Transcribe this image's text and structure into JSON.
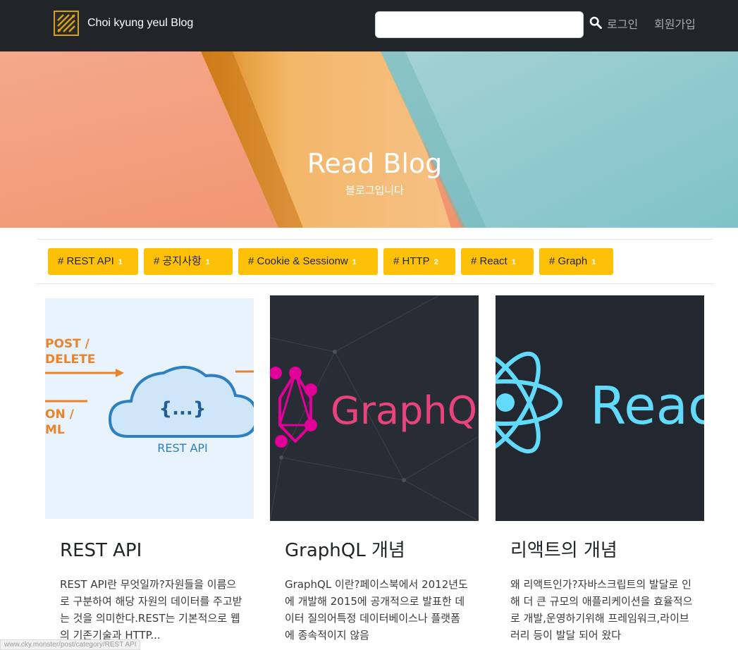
{
  "navbar": {
    "brand": "Choi kyung yeul Blog",
    "search": {
      "value": "",
      "placeholder": ""
    },
    "login": "로그인",
    "signup": "회원가입"
  },
  "hero": {
    "title": "Read Blog",
    "subtitle": "블로그입니다"
  },
  "tags": [
    {
      "label": "# REST API",
      "count": "1"
    },
    {
      "label": "# 공지사항",
      "count": "1"
    },
    {
      "label": "# Cookie & Sessionw",
      "count": "1"
    },
    {
      "label": "# HTTP",
      "count": "2"
    },
    {
      "label": "# React",
      "count": "1"
    },
    {
      "label": "# Graph",
      "count": "1"
    }
  ],
  "posts": [
    {
      "title": "REST API",
      "excerpt": "REST API란 무엇일까?자원들을 이름으로 구분하여 해당 자원의 데이터를 주고받는 것을 의미한다.REST는 기본적으로 웹의 기존기술과 HTTP...",
      "image": {
        "labels": [
          "POST /",
          "DELETE",
          "ON /",
          "ML"
        ],
        "cloud_text": "{...}",
        "caption": "REST API"
      }
    },
    {
      "title": "GraphQL 개념",
      "excerpt": "GraphQL 이란?페이스북에서 2012년도에 개발해 2015에 공개적으로 발표한 데이터 질의어특정 데이터베이스나 플랫폼에 종속적이지 않음",
      "image": {
        "wordmark": "GraphQ"
      }
    },
    {
      "title": "리액트의 개념",
      "excerpt": "왜 리액트인가?자바스크립트의 발달로 인해 더 큰 규모의 애플리케이션을 효율적으로 개발,운영하기위해 프레임워크,라이브러리 등이 발달 되어 왔다",
      "image": {
        "wordmark": "Reac"
      }
    }
  ],
  "status_url": "www.cky.monster/post/category/REST API",
  "colors": {
    "navbar_bg": "#212529",
    "tag_bg": "#ffc107",
    "graphql_pink": "#e10098",
    "react_blue": "#61dafb",
    "rest_orange": "#e8852a",
    "rest_blue": "#2c7fc1"
  }
}
